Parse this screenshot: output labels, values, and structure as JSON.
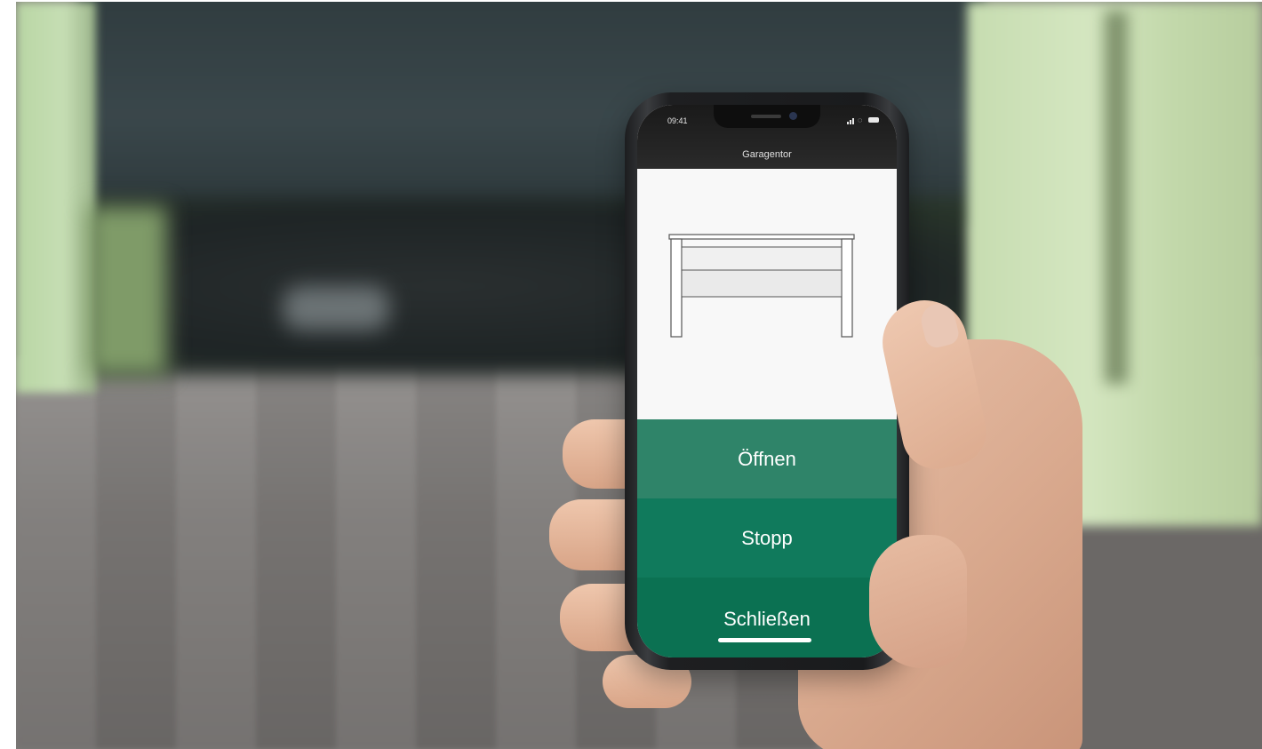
{
  "phone": {
    "status_time": "09:41",
    "app_title": "Garagentor"
  },
  "actions": {
    "open_label": "Öffnen",
    "stop_label": "Stopp",
    "close_label": "Schließen"
  },
  "colors": {
    "open_button": "#2f8469",
    "stop_button": "#107a5c",
    "close_button": "#0b7152",
    "header": "#1a1a1a"
  },
  "icons": {
    "door": "garage-door-icon",
    "signal": "signal-icon",
    "wifi": "wifi-icon",
    "battery": "battery-icon"
  }
}
